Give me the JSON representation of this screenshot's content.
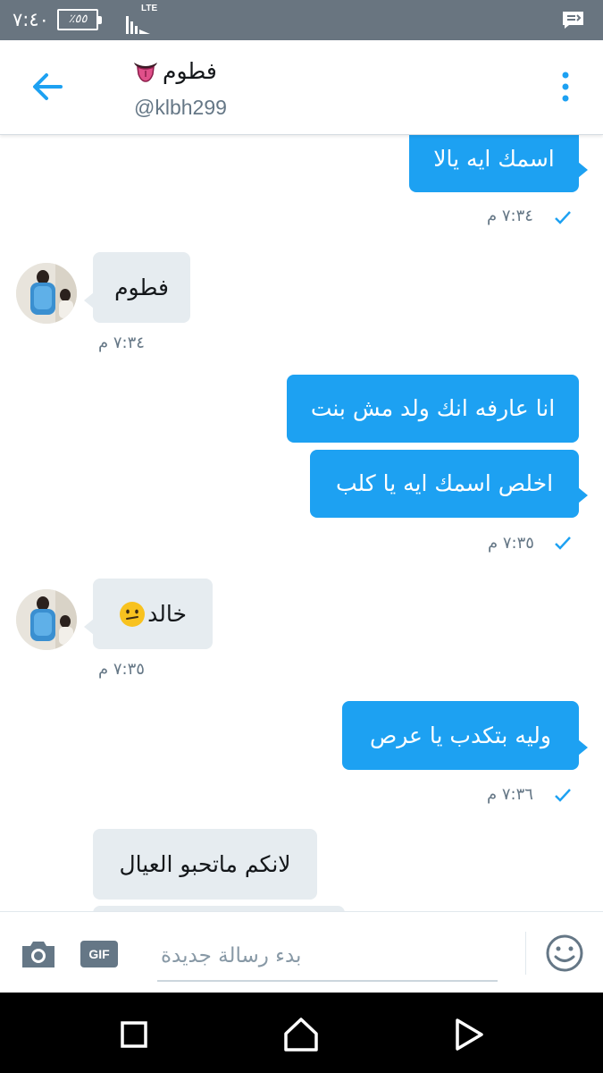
{
  "status_bar": {
    "time": "٧:٤٠",
    "battery": "٪٥٥",
    "network": "LTE",
    "icons": [
      "battery-icon",
      "signal-icon",
      "notification-message-icon"
    ]
  },
  "header": {
    "name": "فطوم",
    "handle": "@klbh299",
    "icons": [
      "back-arrow-icon",
      "tongue-emoji-icon",
      "more-vertical-icon"
    ]
  },
  "messages": [
    {
      "direction": "sent",
      "text": "اسمك ايه يالا"
    },
    {
      "direction": "sent",
      "meta": "٧:٣٤ م",
      "read": true
    },
    {
      "direction": "received",
      "text": "فطوم"
    },
    {
      "direction": "received",
      "meta": "٧:٣٤ م"
    },
    {
      "direction": "sent",
      "text": "انا عارفه انك ولد مش بنت"
    },
    {
      "direction": "sent",
      "text": "اخلص اسمك ايه يا كلب"
    },
    {
      "direction": "sent",
      "meta": "٧:٣٥ م",
      "read": true
    },
    {
      "direction": "received",
      "text": "خالد",
      "emoji": "neutral-face-emoji-icon"
    },
    {
      "direction": "received",
      "meta": "٧:٣٥ م"
    },
    {
      "direction": "sent",
      "text": "وليه بتكدب يا عرص"
    },
    {
      "direction": "sent",
      "meta": "٧:٣٦ م",
      "read": true
    },
    {
      "direction": "received",
      "text": "لانكم ماتحبو العيال"
    }
  ],
  "composer": {
    "placeholder": "بدء رسالة جديدة",
    "gif_label": "GIF",
    "icons": [
      "camera-icon",
      "gif-icon",
      "emoji-smile-icon"
    ]
  },
  "nav_bar": {
    "icons": [
      "recent-apps-icon",
      "home-icon",
      "back-triangle-icon"
    ]
  },
  "colors": {
    "status_bar": "#697580",
    "accent": "#1da1f2",
    "received_bubble": "#e6ecf0",
    "meta_text": "#657786",
    "nav_bar": "#000000"
  }
}
